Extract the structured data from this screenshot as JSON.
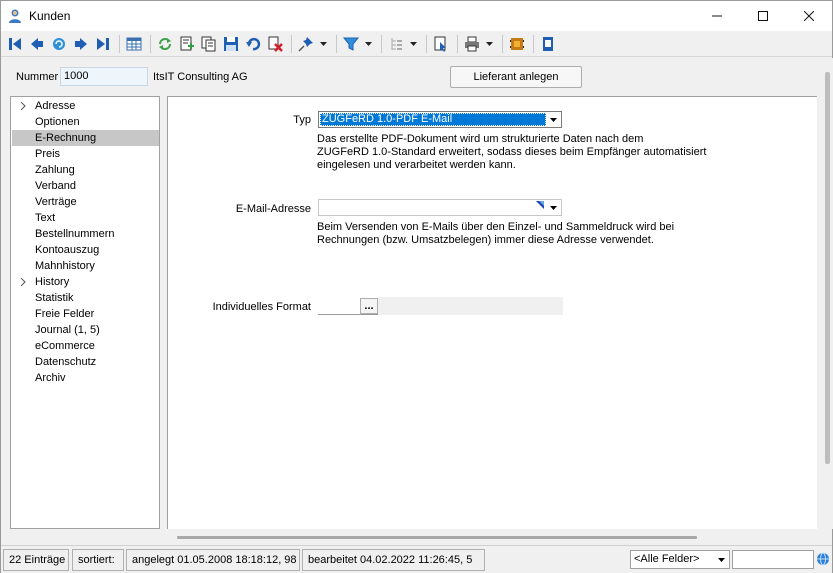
{
  "window": {
    "title": "Kunden",
    "app_icon": "user-icon",
    "controls": [
      "minimize-icon",
      "maximize-icon",
      "close-icon"
    ]
  },
  "toolbar": {
    "buttons": [
      "first-record-icon",
      "previous-record-icon",
      "search-record-icon",
      "next-record-icon",
      "last-record-icon",
      "table-view-icon",
      "refresh-icon",
      "new-record-icon",
      "copy-record-icon",
      "save-icon",
      "undo-icon",
      "delete-icon",
      "pin-icon",
      "filter-icon",
      "tree-icon",
      "report-icon",
      "print-icon",
      "addon-icon",
      "notepad-icon"
    ]
  },
  "header": {
    "nummer_label": "Nummer",
    "nummer_value": "1000",
    "company": "ItsIT Consulting AG",
    "lieferant_button": "Lieferant anlegen"
  },
  "nav": {
    "items": [
      {
        "label": "Adresse",
        "expandable": true
      },
      {
        "label": "Optionen"
      },
      {
        "label": "E-Rechnung",
        "selected": true
      },
      {
        "label": "Preis"
      },
      {
        "label": "Zahlung"
      },
      {
        "label": "Verband"
      },
      {
        "label": "Verträge"
      },
      {
        "label": "Text"
      },
      {
        "label": "Bestellnummern"
      },
      {
        "label": "Kontoauszug"
      },
      {
        "label": "Mahnhistory"
      },
      {
        "label": "History",
        "expandable": true
      },
      {
        "label": "Statistik"
      },
      {
        "label": "Freie Felder"
      },
      {
        "label": "Journal (1, 5)"
      },
      {
        "label": "eCommerce"
      },
      {
        "label": "Datenschutz"
      },
      {
        "label": "Archiv"
      }
    ]
  },
  "form": {
    "typ_label": "Typ",
    "typ_value": "ZUGFeRD 1.0-PDF E-Mail",
    "typ_desc_1": "Das erstellte PDF-Dokument wird um strukturierte Daten nach dem",
    "typ_desc_2": "ZUGFeRD 1.0-Standard erweitert, sodass dieses beim Empfänger automatisiert",
    "typ_desc_3": "eingelesen und verarbeitet werden kann.",
    "email_label": "E-Mail-Adresse",
    "email_value": "",
    "email_desc_1": "Beim Versenden von E-Mails über den Einzel- und Sammeldruck wird bei",
    "email_desc_2": "Rechnungen (bzw. Umsatzbelegen) immer diese Adresse verwendet.",
    "format_label": "Individuelles Format",
    "format_button": "..."
  },
  "status": {
    "count": "22 Einträge",
    "sorted": "sortiert:",
    "created": "angelegt 01.05.2008 18:18:12, 98",
    "edited": "bearbeitet 04.02.2022 11:26:45,  5",
    "field_select": "<Alle Felder>",
    "search_value": ""
  },
  "colors": {
    "selection": "#0078d7",
    "nav_selected": "#c7c7c7",
    "toolbar_blue": "#1e5fb4"
  }
}
